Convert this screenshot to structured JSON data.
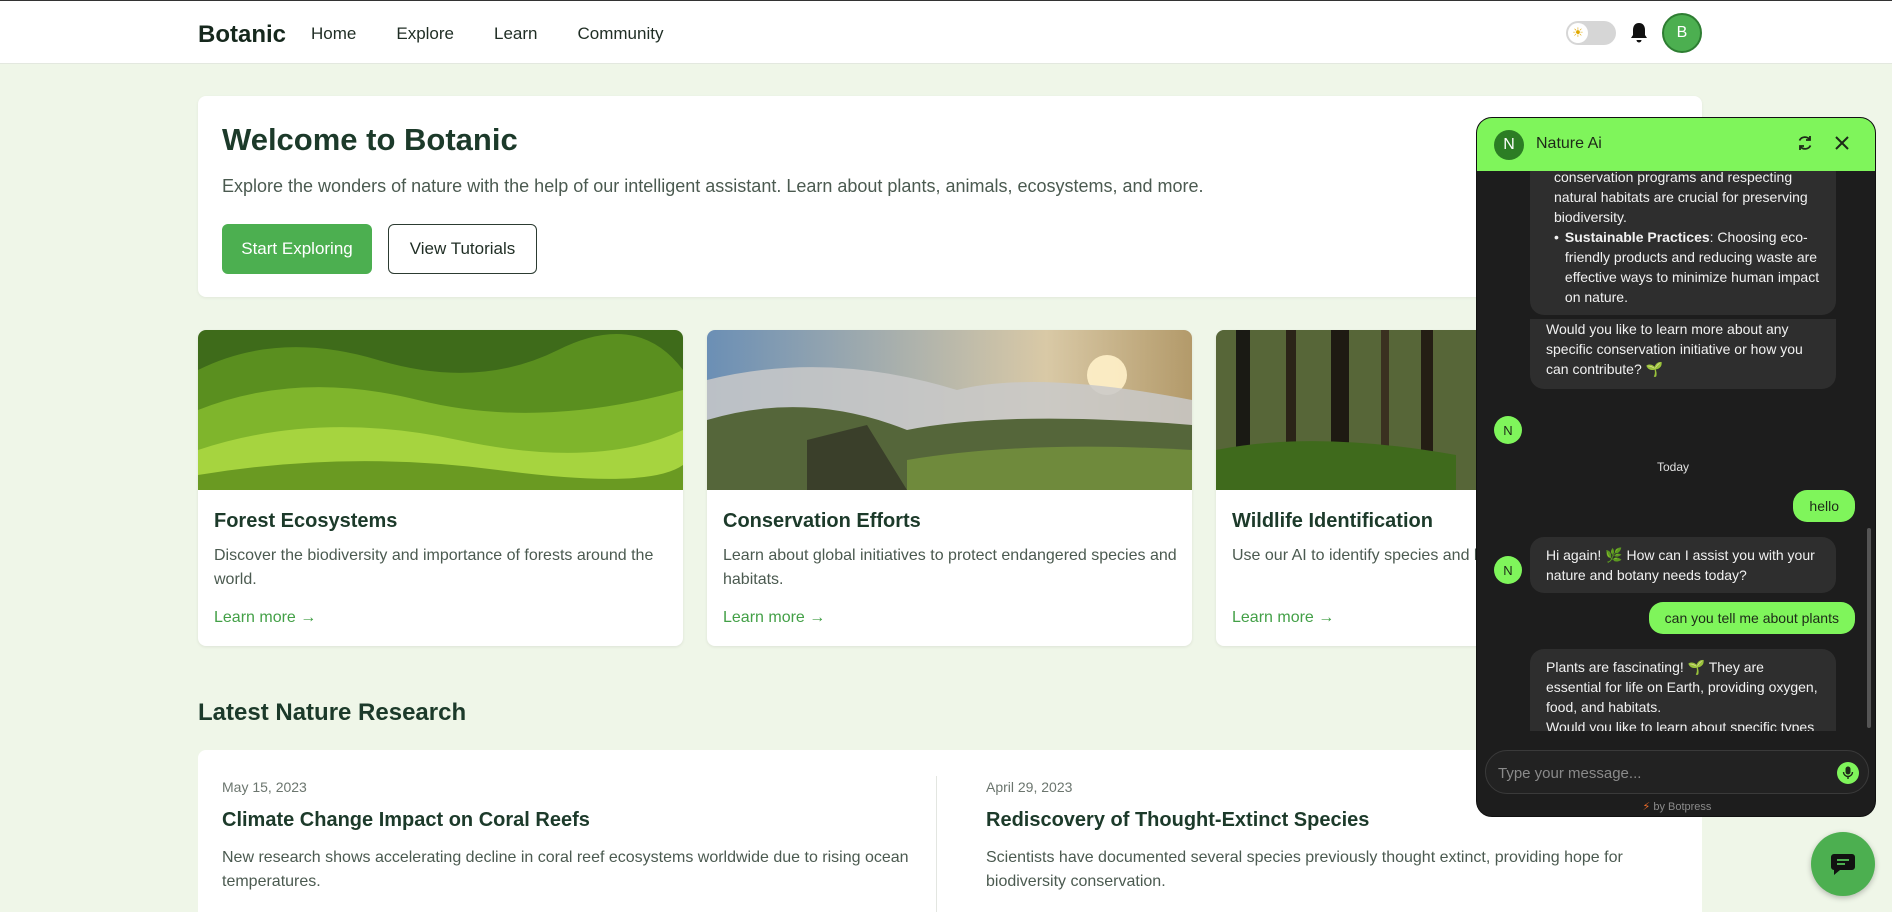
{
  "header": {
    "brand": "Botanic",
    "nav": [
      "Home",
      "Explore",
      "Learn",
      "Community"
    ],
    "avatar_initial": "B"
  },
  "hero": {
    "title": "Welcome to Botanic",
    "subtitle": "Explore the wonders of nature with the help of our intelligent assistant. Learn about plants, animals, ecosystems, and more.",
    "primary_button": "Start Exploring",
    "secondary_button": "View Tutorials"
  },
  "cards": [
    {
      "title": "Forest Ecosystems",
      "description": "Discover the biodiversity and importance of forests around the world.",
      "link": "Learn more →"
    },
    {
      "title": "Conservation Efforts",
      "description": "Learn about global initiatives to protect endangered species and habitats.",
      "link": "Learn more →"
    },
    {
      "title": "Wildlife Identification",
      "description": "Use our AI to identify species and l behaviors.",
      "link": "Learn more →"
    }
  ],
  "research": {
    "heading": "Latest Nature Research",
    "articles": [
      {
        "date": "May 15, 2023",
        "title": "Climate Change Impact on Coral Reefs",
        "summary": "New research shows accelerating decline in coral reef ecosystems worldwide due to rising ocean temperatures."
      },
      {
        "date": "April 29, 2023",
        "title": "Rediscovery of Thought-Extinct Species",
        "summary": "Scientists have documented several species previously thought extinct, providing hope for biodiversity conservation."
      }
    ]
  },
  "chat": {
    "avatar_initial": "N",
    "name": "Nature Ai",
    "bot_initial": "N",
    "partial_text_1": "conservation programs and respecting natural habitats are crucial for preserving biodiversity.",
    "bullet_bold": "Sustainable Practices",
    "bullet_rest": ": Choosing eco-friendly products and reducing waste are effective ways to minimize human impact on nature.",
    "question_1": "Would you like to learn more about any specific conservation initiative or how you can contribute? 🌱",
    "day_label": "Today",
    "user_msg_1": "hello",
    "bot_msg_2": "Hi again! 🌿 How can I assist you with your nature and botany needs today?",
    "user_msg_2": "can you tell me about plants",
    "bot_msg_3a": "Plants are fascinating! 🌱 They are essential for life on Earth, providing oxygen, food, and habitats.",
    "bot_msg_3b": "Would you like to learn about specific types of plants, their care, or their role in ecosystems? Let me know!",
    "input_placeholder": "Type your message...",
    "powered_by": "by Botpress"
  },
  "colors": {
    "accent": "#4caf50",
    "chat_accent": "#7ff55b",
    "page_bg": "#eff6e8"
  }
}
